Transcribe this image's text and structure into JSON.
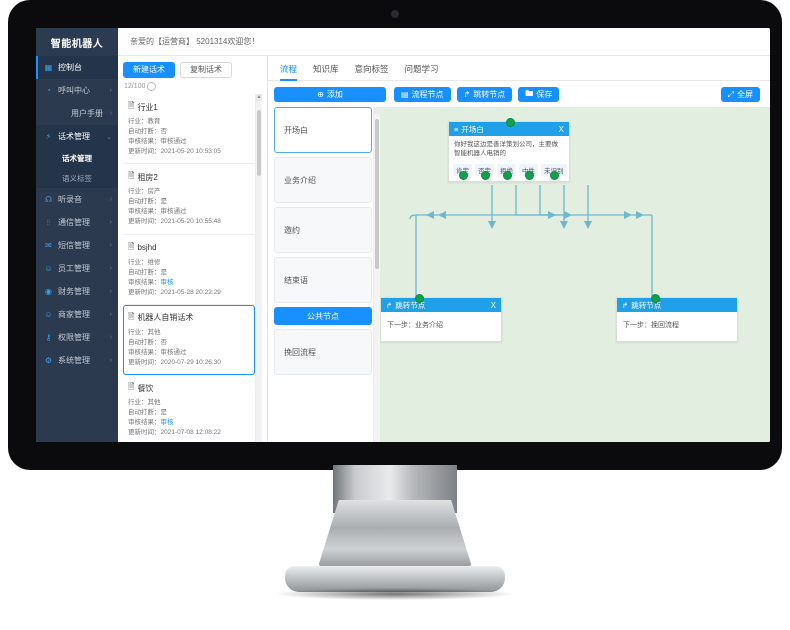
{
  "app": {
    "brand": "智能机器人",
    "welcome": "亲爱的【运营商】 5201314欢迎您！"
  },
  "sidebar": {
    "items": [
      {
        "label": "控制台",
        "icon": "grid-icon",
        "chevron": "",
        "state": "active"
      },
      {
        "label": "呼叫中心",
        "icon": "clock-icon",
        "chevron": "›",
        "state": "normal"
      },
      {
        "label": "用户手册",
        "icon": "",
        "chevron": "›",
        "state": "normal"
      },
      {
        "label": "话术管理",
        "icon": "bolt-icon",
        "chevron": "⌄",
        "state": "open"
      },
      {
        "label": "听录音",
        "icon": "headset-icon",
        "chevron": "›",
        "state": "normal"
      },
      {
        "label": "通信管理",
        "icon": "sliders-icon",
        "chevron": "›",
        "state": "normal"
      },
      {
        "label": "短信管理",
        "icon": "mail-icon",
        "chevron": "›",
        "state": "normal"
      },
      {
        "label": "员工管理",
        "icon": "user-icon",
        "chevron": "›",
        "state": "normal"
      },
      {
        "label": "财务管理",
        "icon": "coin-icon",
        "chevron": "›",
        "state": "normal"
      },
      {
        "label": "商家管理",
        "icon": "user-icon",
        "chevron": "›",
        "state": "normal"
      },
      {
        "label": "权限管理",
        "icon": "key-icon",
        "chevron": "›",
        "state": "normal"
      },
      {
        "label": "系统管理",
        "icon": "gear-icon",
        "chevron": "›",
        "state": "normal"
      }
    ],
    "sub_items": [
      {
        "label": "话术管理",
        "current": true
      },
      {
        "label": "语义标签",
        "current": false
      }
    ]
  },
  "list_panel": {
    "new_button": "新建话术",
    "copy_button": "复制话术",
    "quota": "12/100",
    "labels": {
      "industry": "行业：",
      "interrupt": "自动打断：",
      "audit": "审核结果：",
      "updated": "更新时间："
    },
    "cards": [
      {
        "title": "餐饮",
        "industry": "其他",
        "interrupt": "是",
        "audit": "审核",
        "audit_blue": true,
        "updated": "2021-07-08 12:08:22",
        "selected": false
      },
      {
        "title": "机器人自销话术",
        "industry": "其他",
        "interrupt": "否",
        "audit": "审核通过",
        "audit_blue": false,
        "updated": "2020-07-29 10:26:30",
        "selected": true
      },
      {
        "title": "bsjhd",
        "industry": "维修",
        "interrupt": "是",
        "audit": "审核",
        "audit_blue": true,
        "updated": "2021-05-28 20:22:29",
        "selected": false
      },
      {
        "title": "租房2",
        "industry": "房产",
        "interrupt": "是",
        "audit": "审核通过",
        "audit_blue": false,
        "updated": "2021-05-20 10:55:48",
        "selected": false
      },
      {
        "title": "行业1",
        "industry": "教育",
        "interrupt": "否",
        "audit": "审核通过",
        "audit_blue": false,
        "updated": "2021-05-20 10:53:05",
        "selected": false
      }
    ]
  },
  "main": {
    "tabs": [
      {
        "label": "流程",
        "active": true
      },
      {
        "label": "知识库",
        "active": false
      },
      {
        "label": "意向标签",
        "active": false
      },
      {
        "label": "问题学习",
        "active": false
      }
    ],
    "toolbar": {
      "add": "添加",
      "flow_node": "流程节点",
      "jump_node": "跳转节点",
      "save": "保存",
      "fullscreen": "全屏"
    },
    "node_list": [
      {
        "label": "开场白",
        "style": "selected"
      },
      {
        "label": "业务介绍",
        "style": "normal"
      },
      {
        "label": "邀约",
        "style": "normal"
      },
      {
        "label": "结束语",
        "style": "normal"
      },
      {
        "label": "公共节点",
        "style": "accent"
      },
      {
        "label": "挽回流程",
        "style": "normal"
      }
    ]
  },
  "flow": {
    "nodes": [
      {
        "id": "opening",
        "type": "flow-node",
        "title": "开场白",
        "icon": "menu-icon",
        "close": "X",
        "body": "你好我这边是善洋策划公司，主要做智能机器人电销的",
        "chips": [
          "肯定",
          "否定",
          "拒绝",
          "中性",
          "未识别"
        ]
      },
      {
        "id": "jump-left",
        "type": "jump-node",
        "title": "跳转节点",
        "icon": "arrow-icon",
        "close": "X",
        "body": "下一步：业务介绍",
        "chips": []
      },
      {
        "id": "jump-right",
        "type": "jump-node",
        "title": "跳转节点",
        "icon": "arrow-icon",
        "close": "",
        "body": "下一步：挽回流程",
        "chips": []
      }
    ],
    "colors": {
      "canvas_bg": "#e2eedf",
      "node_header": "#1fa0e8",
      "connector": "#6fb8cf",
      "port": "#12a04b",
      "accent": "#1890ff"
    }
  }
}
